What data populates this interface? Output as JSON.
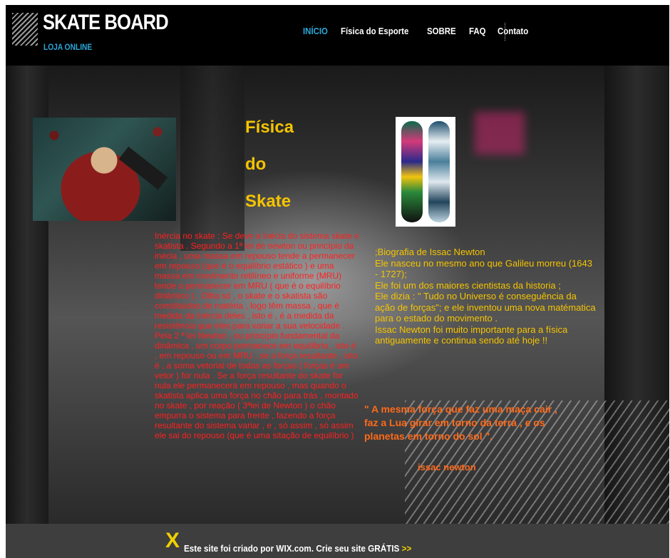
{
  "header": {
    "brand_title": "SKATE BOARD",
    "brand_subtitle": "LOJA ONLINE",
    "nav": [
      {
        "label": "INÍCIO"
      },
      {
        "label": "Física do Esporte"
      },
      {
        "label": "SOBRE"
      },
      {
        "label": "FAQ"
      },
      {
        "label": "Contato"
      }
    ]
  },
  "main": {
    "title_lines": [
      "Física",
      "do",
      "Skate"
    ],
    "inertia_text": "Inércia no skate : Se deve a inécia do sistema skate e skatista . Segundo a 1ª lei de newton ou princípio da inécia , uma massa em repouso tende a permanecer em repouso (que é o equilíbrio estático ) e uma massa em movimento retilíneo e uniforme (MRU) tende a permanecer em MRU ( que é o equilíbrio dinâmico ) . Olha só , o skate e o skatista são constituídos de matéria , logo têm massa , que é medida da inércia deles , isto é , é a medida da resistência que eles para variar a sua velocidade . Pela 2 ª lei Newton , ou princípio fundamental da dinâmica , um corpo permanece em equilíbrio , isto é , em repouso ou em MRU , se a força resultante , isto é , a soma vetorial de todas as forças ( forças é um vetor ) for nula . Se a força resultante do skate for nula ele permanecerá em repouso , mas quando o skatista aplica uma força no chão para trás , montado no skate , por reação ( 3ªlei de Newton ) o chão empurra o sistema para frente , fazendo a força resultante do sistema variar , e , só assim , só assim ele sai do repouso (que é uma sitação de equilíbrio )",
    "bio_lines": [
      ";Biografia de Issac Newton",
      "Ele nasceu no mesmo ano que Galileu morreu (1643 - 1727);",
      "Ele foi um dos maiores cientistas da historia ;",
      "Ele dizia : \" Tudo no Universo é conseguência da ação de forças\"; e ele inventou uma nova matématica para o estado do movimento .",
      "Issac Newton foi muito importante para a física antiguamente e continua sendo até hoje !!"
    ],
    "quote": "\" A mesma força que faz uma maça cair , faz a Lua girar em torno da terra , e os planetas em torno do sol \".",
    "quote_author": "issac newton"
  },
  "footer": {
    "prefix": "Este site foi criado por",
    "brand": "WIX.com",
    "suffix": ". Crie seu site GRÁTIS",
    "arrows": ">>"
  },
  "colors": {
    "nav_active": "#2aa7d8",
    "title": "#f5c400",
    "inertia_text": "#ff2020",
    "quote": "#ff6a1a",
    "wix_logo": "#f0d000"
  }
}
